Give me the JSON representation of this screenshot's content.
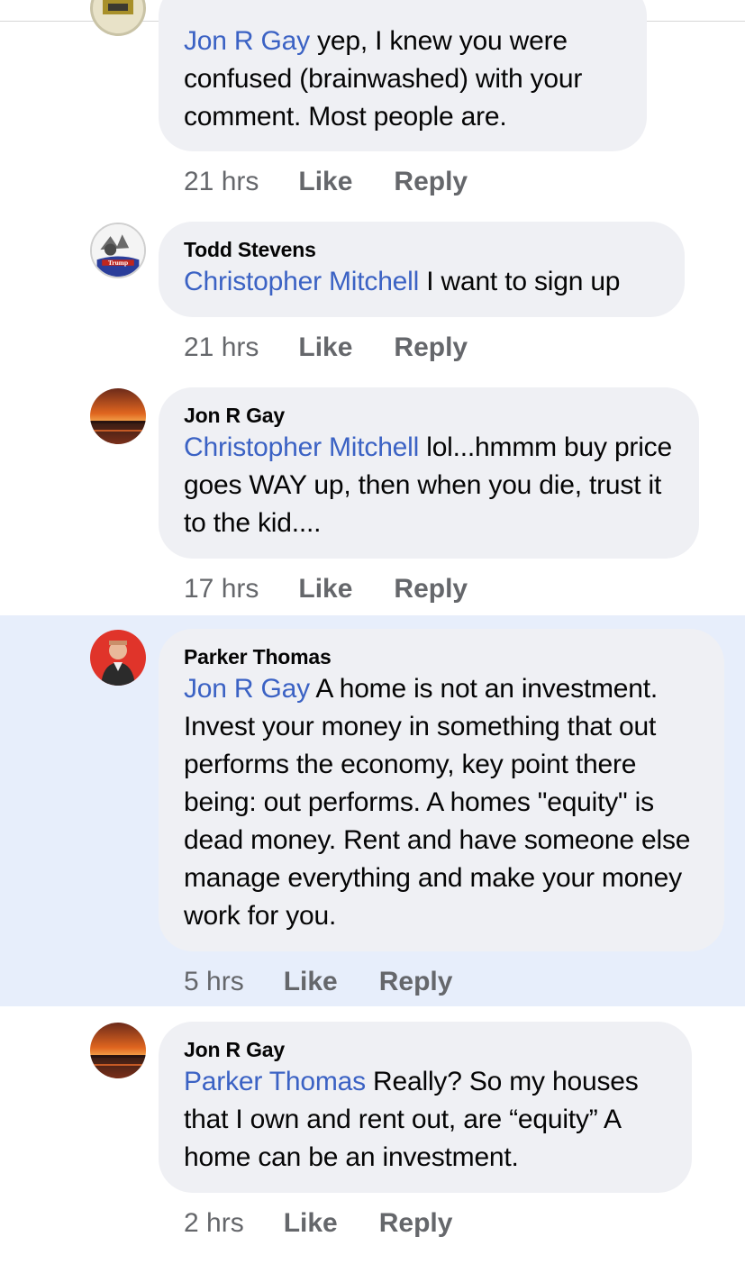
{
  "comments": [
    {
      "author": "",
      "mention": "Jon R Gay",
      "text": " yep, I knew you were confused (brainwashed) with your comment. Most people are.",
      "time": "21 hrs",
      "like_label": "Like",
      "reply_label": "Reply"
    },
    {
      "author": "Todd Stevens",
      "mention": "Christopher Mitchell",
      "text": " I want to sign up",
      "time": "21 hrs",
      "like_label": "Like",
      "reply_label": "Reply",
      "avatar_text": "Trump"
    },
    {
      "author": "Jon R Gay",
      "mention": "Christopher Mitchell",
      "text": " lol...hmmm buy price goes WAY up, then when you die, trust it to the kid....",
      "time": "17 hrs",
      "like_label": "Like",
      "reply_label": "Reply"
    },
    {
      "author": "Parker Thomas",
      "mention": "Jon R Gay",
      "text": " A home is not an investment. Invest your money in something that out performs the economy, key point there being: out performs. A homes \"equity\" is dead money. Rent and have someone else manage everything and make your money work for you.",
      "time": "5 hrs",
      "like_label": "Like",
      "reply_label": "Reply"
    },
    {
      "author": "Jon R Gay",
      "mention": "Parker Thomas",
      "text": " Really? So my houses that I own and rent out, are “equity” A home can be an investment.",
      "time": "2 hrs",
      "like_label": "Like",
      "reply_label": "Reply"
    }
  ],
  "colors": {
    "mention": "#3b62c4",
    "bubble": "#eff0f4",
    "highlight": "#e7eefb",
    "meta": "#65676b"
  }
}
